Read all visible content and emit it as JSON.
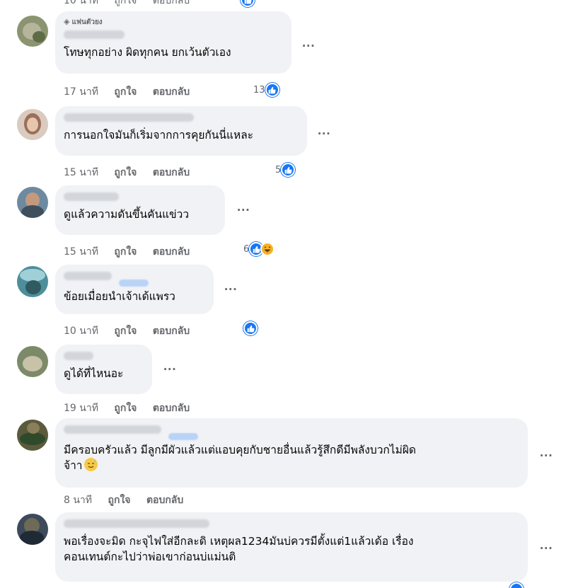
{
  "top_partial": {
    "time": "10 นาที",
    "like": "ถูกใจ",
    "reply": "ตอบกลับ"
  },
  "labels": {
    "like": "ถูกใจ",
    "reply": "ตอบกลับ",
    "more": "···"
  },
  "colors": {
    "bubble": "#f0f2f5",
    "meta": "#65676b",
    "text": "#050505",
    "like_blue": "#1877f2"
  },
  "comments": [
    {
      "badge": "แฟนตัวยง",
      "badge_icon": "diamond-icon",
      "text": "โทษทุกอย่าง ผิดทุกคน ยกเว้นตัวเอง",
      "time": "17 นาที",
      "reactions": "13",
      "reaction_types": [
        "like"
      ]
    },
    {
      "text": "การนอกใจมันก็เริ่มจากการคุยกันนี่แหละ",
      "time": "15 นาที",
      "reactions": "5",
      "reaction_types": [
        "like"
      ]
    },
    {
      "text": "ดูแล้วความดันขึ้นคันแข่วว",
      "time": "15 นาที",
      "reactions": "6",
      "reaction_types": [
        "like",
        "haha"
      ]
    },
    {
      "text": "ข้อยเมื่อยนำเจ้าเด้แพรว",
      "time": "10 นาที",
      "reactions": "",
      "reaction_types": [
        "like"
      ]
    },
    {
      "text": "ดูได้ที่ไหนอะ",
      "time": "19 นาที",
      "reactions": "",
      "reaction_types": []
    },
    {
      "text": "มีครอบครัวแล้ว มีลูกมีผัวแล้วแต่แอบคุยกับชายอื่นแล้วรู้สึกดีมีพลังบวกไม่ผิด",
      "text2": "จ้าา",
      "time": "8 นาที",
      "reactions": "",
      "reaction_types": []
    },
    {
      "text": "พอเรื่องจะมิด กะจุไฟใส่อีกละดิ เหตุผล1234มันบ่ควรมีตั้งแต่1แล้วเด้อ เรื่อง",
      "text2": "คอนเทนต์กะไปว่าพ่อเขาก่อนบ่แม่นติ",
      "time": "",
      "reactions": "",
      "reaction_types": []
    }
  ]
}
